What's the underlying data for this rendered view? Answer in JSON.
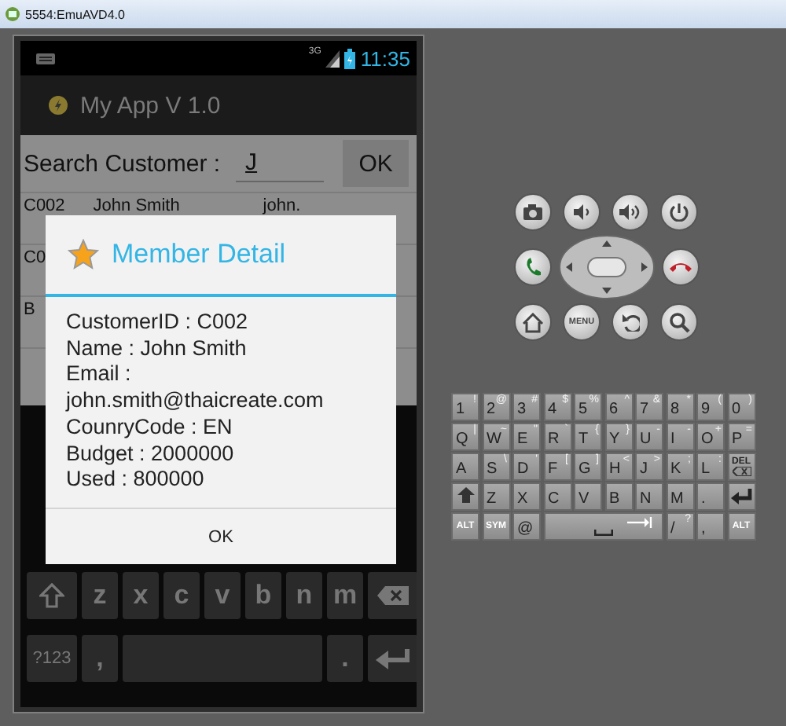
{
  "window": {
    "title": "5554:EmuAVD4.0"
  },
  "status_bar": {
    "network": "3G",
    "time": "11:35"
  },
  "action_bar": {
    "title": "My App V 1.0"
  },
  "search": {
    "label": "Search Customer :",
    "value": "J",
    "button": "OK"
  },
  "list_rows": [
    {
      "cells": [
        "C002",
        "John  Smith",
        "john."
      ]
    },
    {
      "cells": [
        "C0"
      ]
    },
    {
      "cells": [
        "B"
      ]
    }
  ],
  "dialog": {
    "title": "Member Detail",
    "lines": [
      "CustomerID : C002",
      "Name : John  Smith",
      "Email : john.smith@thaicreate.com",
      "CounryCode : EN",
      "Budget : 2000000",
      "Used : 800000"
    ],
    "button": "OK"
  },
  "soft_keyboard": {
    "rows": [
      {
        "keys": [
          {
            "kind": "shift"
          },
          {
            "kind": "char",
            "label": "z"
          },
          {
            "kind": "char",
            "label": "x"
          },
          {
            "kind": "char",
            "label": "c"
          },
          {
            "kind": "char",
            "label": "v"
          },
          {
            "kind": "char",
            "label": "b"
          },
          {
            "kind": "char",
            "label": "n"
          },
          {
            "kind": "char",
            "label": "m"
          },
          {
            "kind": "backspace"
          }
        ]
      },
      {
        "keys": [
          {
            "kind": "mode",
            "label": "?123"
          },
          {
            "kind": "char",
            "label": ","
          },
          {
            "kind": "space"
          },
          {
            "kind": "char",
            "label": "."
          },
          {
            "kind": "enter"
          }
        ]
      }
    ]
  },
  "hardware_buttons": [
    [
      {
        "kind": "camera"
      },
      {
        "kind": "volume-down"
      },
      {
        "kind": "volume-up"
      },
      {
        "kind": "power"
      }
    ],
    [
      {
        "kind": "call"
      },
      {
        "kind": "dpad"
      },
      {
        "kind": "hangup"
      }
    ],
    [
      {
        "kind": "home"
      },
      {
        "kind": "menu",
        "label": "MENU"
      },
      {
        "kind": "back"
      },
      {
        "kind": "search"
      }
    ]
  ],
  "hardware_keyboard": {
    "rows": [
      {
        "keys": [
          {
            "kind": "char",
            "label": "1",
            "alt": "!"
          },
          {
            "kind": "char",
            "label": "2",
            "alt": "@"
          },
          {
            "kind": "char",
            "label": "3",
            "alt": "#"
          },
          {
            "kind": "char",
            "label": "4",
            "alt": "$"
          },
          {
            "kind": "char",
            "label": "5",
            "alt": "%"
          },
          {
            "kind": "char",
            "label": "6",
            "alt": "^"
          },
          {
            "kind": "char",
            "label": "7",
            "alt": "&"
          },
          {
            "kind": "char",
            "label": "8",
            "alt": "*"
          },
          {
            "kind": "char",
            "label": "9",
            "alt": "("
          },
          {
            "kind": "char",
            "label": "0",
            "alt": ")"
          }
        ]
      },
      {
        "keys": [
          {
            "kind": "char",
            "label": "Q",
            "alt": "|"
          },
          {
            "kind": "char",
            "label": "W",
            "alt": "~"
          },
          {
            "kind": "char",
            "label": "E",
            "alt": "\""
          },
          {
            "kind": "char",
            "label": "R",
            "alt": "`"
          },
          {
            "kind": "char",
            "label": "T",
            "alt": "{"
          },
          {
            "kind": "char",
            "label": "Y",
            "alt": "}"
          },
          {
            "kind": "char",
            "label": "U",
            "alt": "-"
          },
          {
            "kind": "char",
            "label": "I",
            "alt": "-"
          },
          {
            "kind": "char",
            "label": "O",
            "alt": "+"
          },
          {
            "kind": "char",
            "label": "P",
            "alt": "="
          }
        ]
      },
      {
        "keys": [
          {
            "kind": "char",
            "label": "A"
          },
          {
            "kind": "char",
            "label": "S",
            "alt": "\\"
          },
          {
            "kind": "char",
            "label": "D",
            "alt": "'"
          },
          {
            "kind": "char",
            "label": "F",
            "alt": "["
          },
          {
            "kind": "char",
            "label": "G",
            "alt": "]"
          },
          {
            "kind": "char",
            "label": "H",
            "alt": "<"
          },
          {
            "kind": "char",
            "label": "J",
            "alt": ">"
          },
          {
            "kind": "char",
            "label": "K",
            "alt": ";"
          },
          {
            "kind": "char",
            "label": "L",
            "alt": ":"
          },
          {
            "kind": "del",
            "label": "DEL"
          }
        ]
      },
      {
        "keys": [
          {
            "kind": "shift"
          },
          {
            "kind": "char",
            "label": "Z"
          },
          {
            "kind": "char",
            "label": "X"
          },
          {
            "kind": "char",
            "label": "C"
          },
          {
            "kind": "char",
            "label": "V"
          },
          {
            "kind": "char",
            "label": "B"
          },
          {
            "kind": "char",
            "label": "N"
          },
          {
            "kind": "char",
            "label": "M"
          },
          {
            "kind": "char",
            "label": "."
          },
          {
            "kind": "enter"
          }
        ]
      },
      {
        "keys": [
          {
            "kind": "char",
            "label": "ALT"
          },
          {
            "kind": "char",
            "label": "SYM"
          },
          {
            "kind": "char",
            "label": "@"
          },
          {
            "kind": "space"
          },
          {
            "kind": "char",
            "label": "/",
            "alt": "?"
          },
          {
            "kind": "char",
            "label": ","
          },
          {
            "kind": "char",
            "label": "ALT"
          }
        ]
      }
    ]
  }
}
